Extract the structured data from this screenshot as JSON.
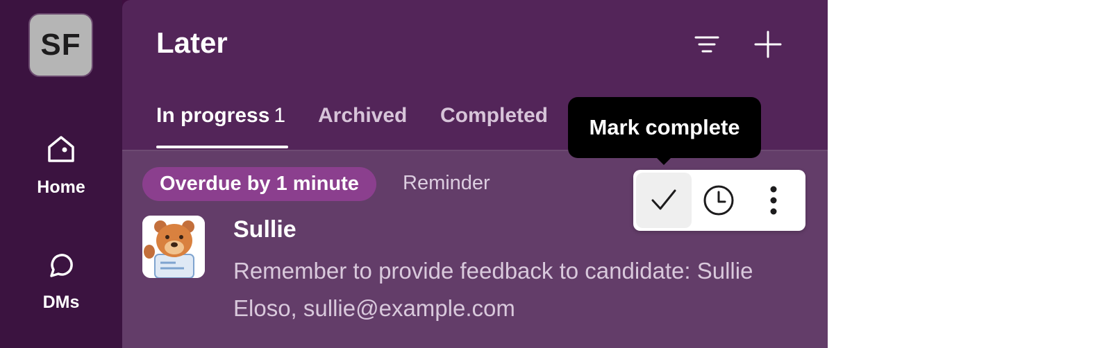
{
  "workspace": {
    "initials": "SF",
    "avatar_color": "#b5b5b5"
  },
  "rail": {
    "items": [
      {
        "label": "Home",
        "icon": "home-icon"
      },
      {
        "label": "DMs",
        "icon": "chat-bubble-icon"
      }
    ]
  },
  "panel": {
    "title": "Later",
    "header_icons": [
      "filter-icon",
      "plus-icon"
    ]
  },
  "tabs": [
    {
      "label": "In progress",
      "count": "1",
      "active": true
    },
    {
      "label": "Archived",
      "active": false
    },
    {
      "label": "Completed",
      "active": false
    }
  ],
  "item": {
    "badge": "Overdue by 1 minute",
    "type": "Reminder",
    "sender": "Sullie",
    "message": "Remember to provide feedback to candidate: Sullie Eloso, sullie@example.com",
    "avatar_icon": "bear-mascot-icon"
  },
  "actions": {
    "items": [
      "checkmark-icon",
      "clock-icon",
      "more-vertical-icon"
    ]
  },
  "tooltip": {
    "text": "Mark complete"
  },
  "colors": {
    "panel_bg": "#532559",
    "rail_bg": "#3b1340",
    "badge_bg": "#8b3f8e",
    "item_bg": "#633d69"
  }
}
